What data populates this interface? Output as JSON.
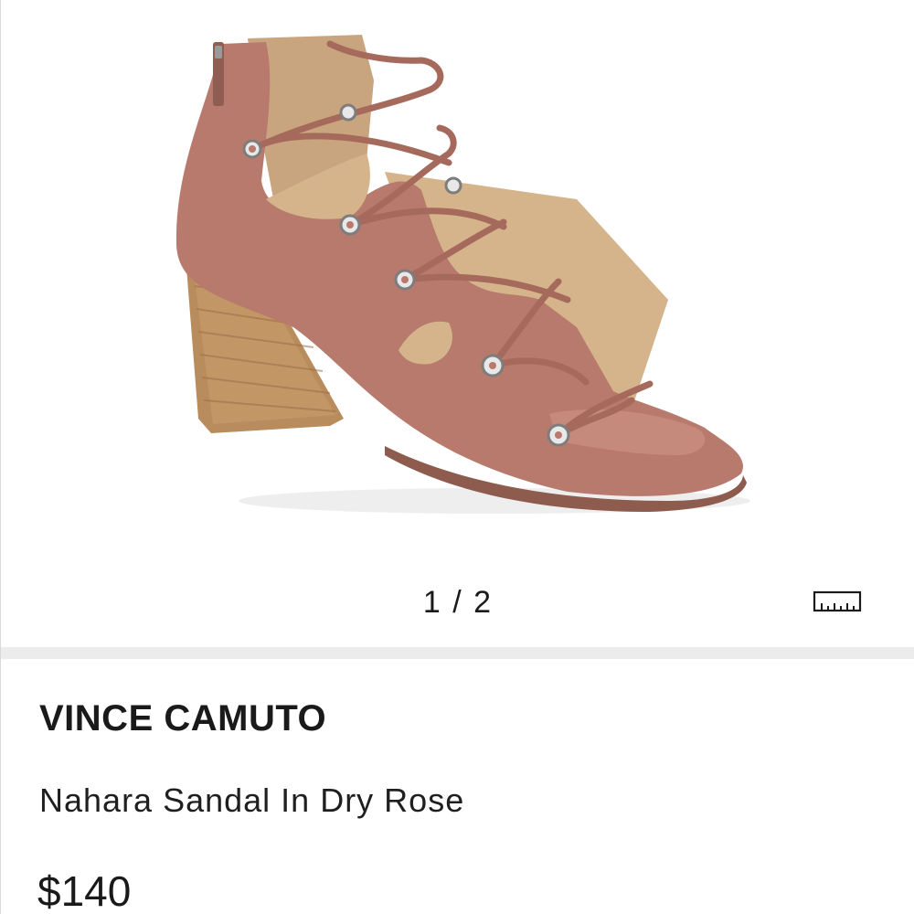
{
  "gallery": {
    "image_alt_icon": "lace-up-block-heel-sandal-image",
    "current_image": "1",
    "total_images": "2",
    "counter_text": "1 / 2",
    "size_guide_icon": "ruler-icon"
  },
  "product": {
    "brand": "VINCE CAMUTO",
    "name": "Nahara Sandal In Dry Rose",
    "price": "$140"
  },
  "colors": {
    "sandal_suede": "#b77a6c",
    "heel_wood": "#b98c5e",
    "divider": "#ececec",
    "text": "#1a1a1a"
  }
}
